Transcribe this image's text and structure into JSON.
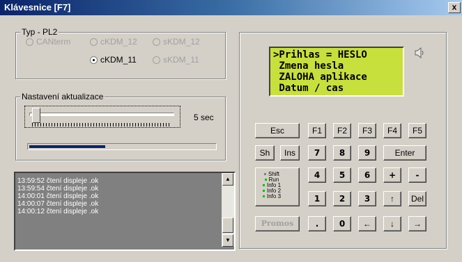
{
  "window": {
    "title": "Klávesnice [F7]",
    "close_label": "x"
  },
  "type_group": {
    "legend": "Typ - PL2",
    "options": [
      {
        "label": "CANterm",
        "checked": false,
        "enabled": false
      },
      {
        "label": "cKDM_12",
        "checked": false,
        "enabled": false
      },
      {
        "label": "sKDM_12",
        "checked": false,
        "enabled": false
      },
      {
        "label": "cKDM_11",
        "checked": true,
        "enabled": true
      },
      {
        "label": "sKDM_11",
        "checked": false,
        "enabled": false
      }
    ]
  },
  "update_group": {
    "legend": "Nastavení aktualizace",
    "interval_label": "5 sec",
    "slider_level": 0.02,
    "progress": 0.41
  },
  "log": {
    "lines": [
      "13:59:52 čtení displeje .ok",
      "13:59:54 čtení displeje .ok",
      "14:00:01 čtení displeje .ok",
      "14:00:07 čtení displeje .ok",
      "14:00:12 čtení displeje .ok"
    ]
  },
  "display": {
    "lines": [
      ">Prihlas = HESLO",
      " Zmena hesla",
      " ZALOHA aplikace",
      " Datum / cas"
    ],
    "color": "#c8e03c"
  },
  "keys": {
    "esc": "Esc",
    "f1": "F1",
    "f2": "F2",
    "f3": "F3",
    "f4": "F4",
    "f5": "F5",
    "sh": "Sh",
    "ins": "Ins",
    "k7": "7",
    "k8": "8",
    "k9": "9",
    "enter": "Enter",
    "k4": "4",
    "k5": "5",
    "k6": "6",
    "plus": "+",
    "minus": "-",
    "k1": "1",
    "k2": "2",
    "k3": "3",
    "up": "↑",
    "del": "Del",
    "promos": "Promos",
    "dot": ".",
    "k0": "0",
    "left": "←",
    "down": "↓",
    "right": "→"
  },
  "status": {
    "items": [
      {
        "label": "Shift",
        "color": "#808080"
      },
      {
        "label": "Run",
        "color": "#00c000"
      },
      {
        "label": "Info 1",
        "color": "#00c000"
      },
      {
        "label": "Info 2",
        "color": "#00c000"
      },
      {
        "label": "Info 3",
        "color": "#00c000"
      }
    ]
  },
  "icons": {
    "speaker": "speaker-icon",
    "scroll_up": "arrow-up-icon",
    "scroll_down": "arrow-down-icon"
  }
}
